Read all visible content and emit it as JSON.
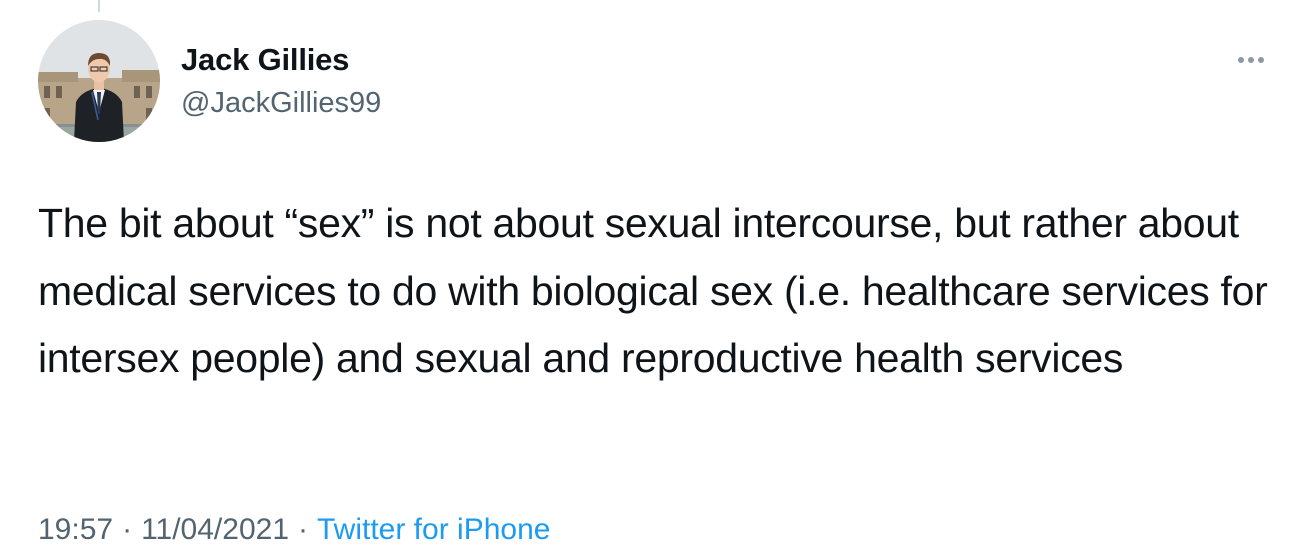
{
  "tweet": {
    "author": {
      "display_name": "Jack Gillies",
      "handle": "@JackGillies99"
    },
    "text": "The bit about “sex” is not about sexual intercourse, but rather about medical services to do with biological sex (i.e. healthcare services for intersex people) and sexual and reproductive health services",
    "time": "19:57",
    "date": "11/04/2021",
    "separator": "·",
    "source": "Twitter for iPhone"
  },
  "icons": {
    "more": "more-dots-icon",
    "avatar": "profile-photo"
  },
  "colors": {
    "text_primary": "#0f1419",
    "text_secondary": "#536471",
    "link": "#1d9bf0",
    "thread_line": "#cfd9de",
    "background": "#ffffff"
  }
}
